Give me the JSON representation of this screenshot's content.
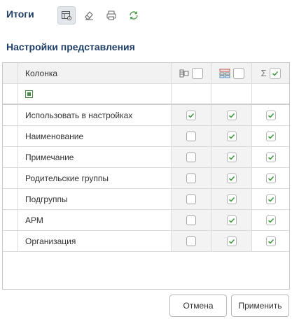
{
  "panel": {
    "title": "Итоги"
  },
  "toolbar": {
    "buttons": [
      {
        "icon": "grid-settings-icon",
        "active": true
      },
      {
        "icon": "eraser-icon",
        "active": false
      },
      {
        "icon": "printer-icon",
        "active": false
      },
      {
        "icon": "refresh-icon",
        "active": false
      }
    ]
  },
  "section": {
    "title": "Настройки представления"
  },
  "grid": {
    "header": {
      "column_label": "Колонка",
      "col2": {
        "icon": "group-rows-icon",
        "checked": false
      },
      "col3": {
        "icon": "group-columns-icon",
        "checked": false
      },
      "col4": {
        "icon": "sigma-icon",
        "symbol": "Σ",
        "checked": true
      }
    },
    "rows": [
      {
        "label": "Использовать в настройках",
        "c2": true,
        "c3": true,
        "c4": true
      },
      {
        "label": "Наименование",
        "c2": false,
        "c3": true,
        "c4": true
      },
      {
        "label": "Примечание",
        "c2": false,
        "c3": true,
        "c4": true
      },
      {
        "label": "Родительские группы",
        "c2": false,
        "c3": true,
        "c4": true
      },
      {
        "label": "Подгруппы",
        "c2": false,
        "c3": true,
        "c4": true
      },
      {
        "label": "АРМ",
        "c2": false,
        "c3": true,
        "c4": true
      },
      {
        "label": "Организация",
        "c2": false,
        "c3": true,
        "c4": true
      }
    ]
  },
  "buttons": {
    "cancel": "Отмена",
    "apply": "Применить"
  },
  "colors": {
    "title": "#1f3f66",
    "check": "#3f9a3f",
    "filter": "#4a8a4a"
  }
}
